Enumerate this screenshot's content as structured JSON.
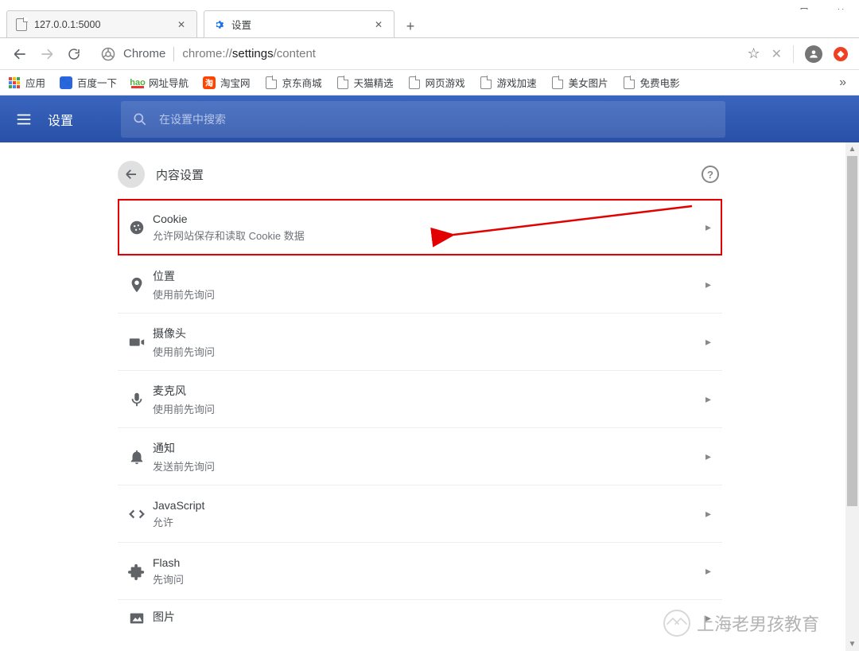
{
  "window": {
    "minimize": "—",
    "maximize": "☐",
    "close": "✕"
  },
  "tabs": [
    {
      "title": "127.0.0.1:5000",
      "active": false,
      "favicon": "file"
    },
    {
      "title": "设置",
      "active": true,
      "favicon": "gear"
    }
  ],
  "newtab": "+",
  "toolbar": {
    "back": "←",
    "forward": "→",
    "reload": "↻",
    "origin": "Chrome",
    "url_prefix": "chrome://",
    "url_bold": "settings",
    "url_suffix": "/content",
    "star": "☆"
  },
  "bookmarks": [
    {
      "label": "应用",
      "icon": "apps"
    },
    {
      "label": "百度一下",
      "icon": "paw"
    },
    {
      "label": "网址导航",
      "icon": "hao"
    },
    {
      "label": "淘宝网",
      "icon": "tb"
    },
    {
      "label": "京东商城",
      "icon": "file"
    },
    {
      "label": "天猫精选",
      "icon": "file"
    },
    {
      "label": "网页游戏",
      "icon": "file"
    },
    {
      "label": "游戏加速",
      "icon": "file"
    },
    {
      "label": "美女图片",
      "icon": "file"
    },
    {
      "label": "免费电影",
      "icon": "file"
    }
  ],
  "bookmarks_overflow": "»",
  "settings_header": {
    "title": "设置",
    "search_placeholder": "在设置中搜索"
  },
  "card": {
    "title": "内容设置",
    "help": "?"
  },
  "rows": [
    {
      "icon": "cookie",
      "title": "Cookie",
      "subtitle": "允许网站保存和读取 Cookie 数据",
      "highlight": true
    },
    {
      "icon": "location",
      "title": "位置",
      "subtitle": "使用前先询问"
    },
    {
      "icon": "camera",
      "title": "摄像头",
      "subtitle": "使用前先询问"
    },
    {
      "icon": "mic",
      "title": "麦克风",
      "subtitle": "使用前先询问"
    },
    {
      "icon": "bell",
      "title": "通知",
      "subtitle": "发送前先询问"
    },
    {
      "icon": "code",
      "title": "JavaScript",
      "subtitle": "允许"
    },
    {
      "icon": "puzzle",
      "title": "Flash",
      "subtitle": "先询问"
    },
    {
      "icon": "image",
      "title": "图片",
      "subtitle": ""
    }
  ],
  "watermark": "上海老男孩教育"
}
